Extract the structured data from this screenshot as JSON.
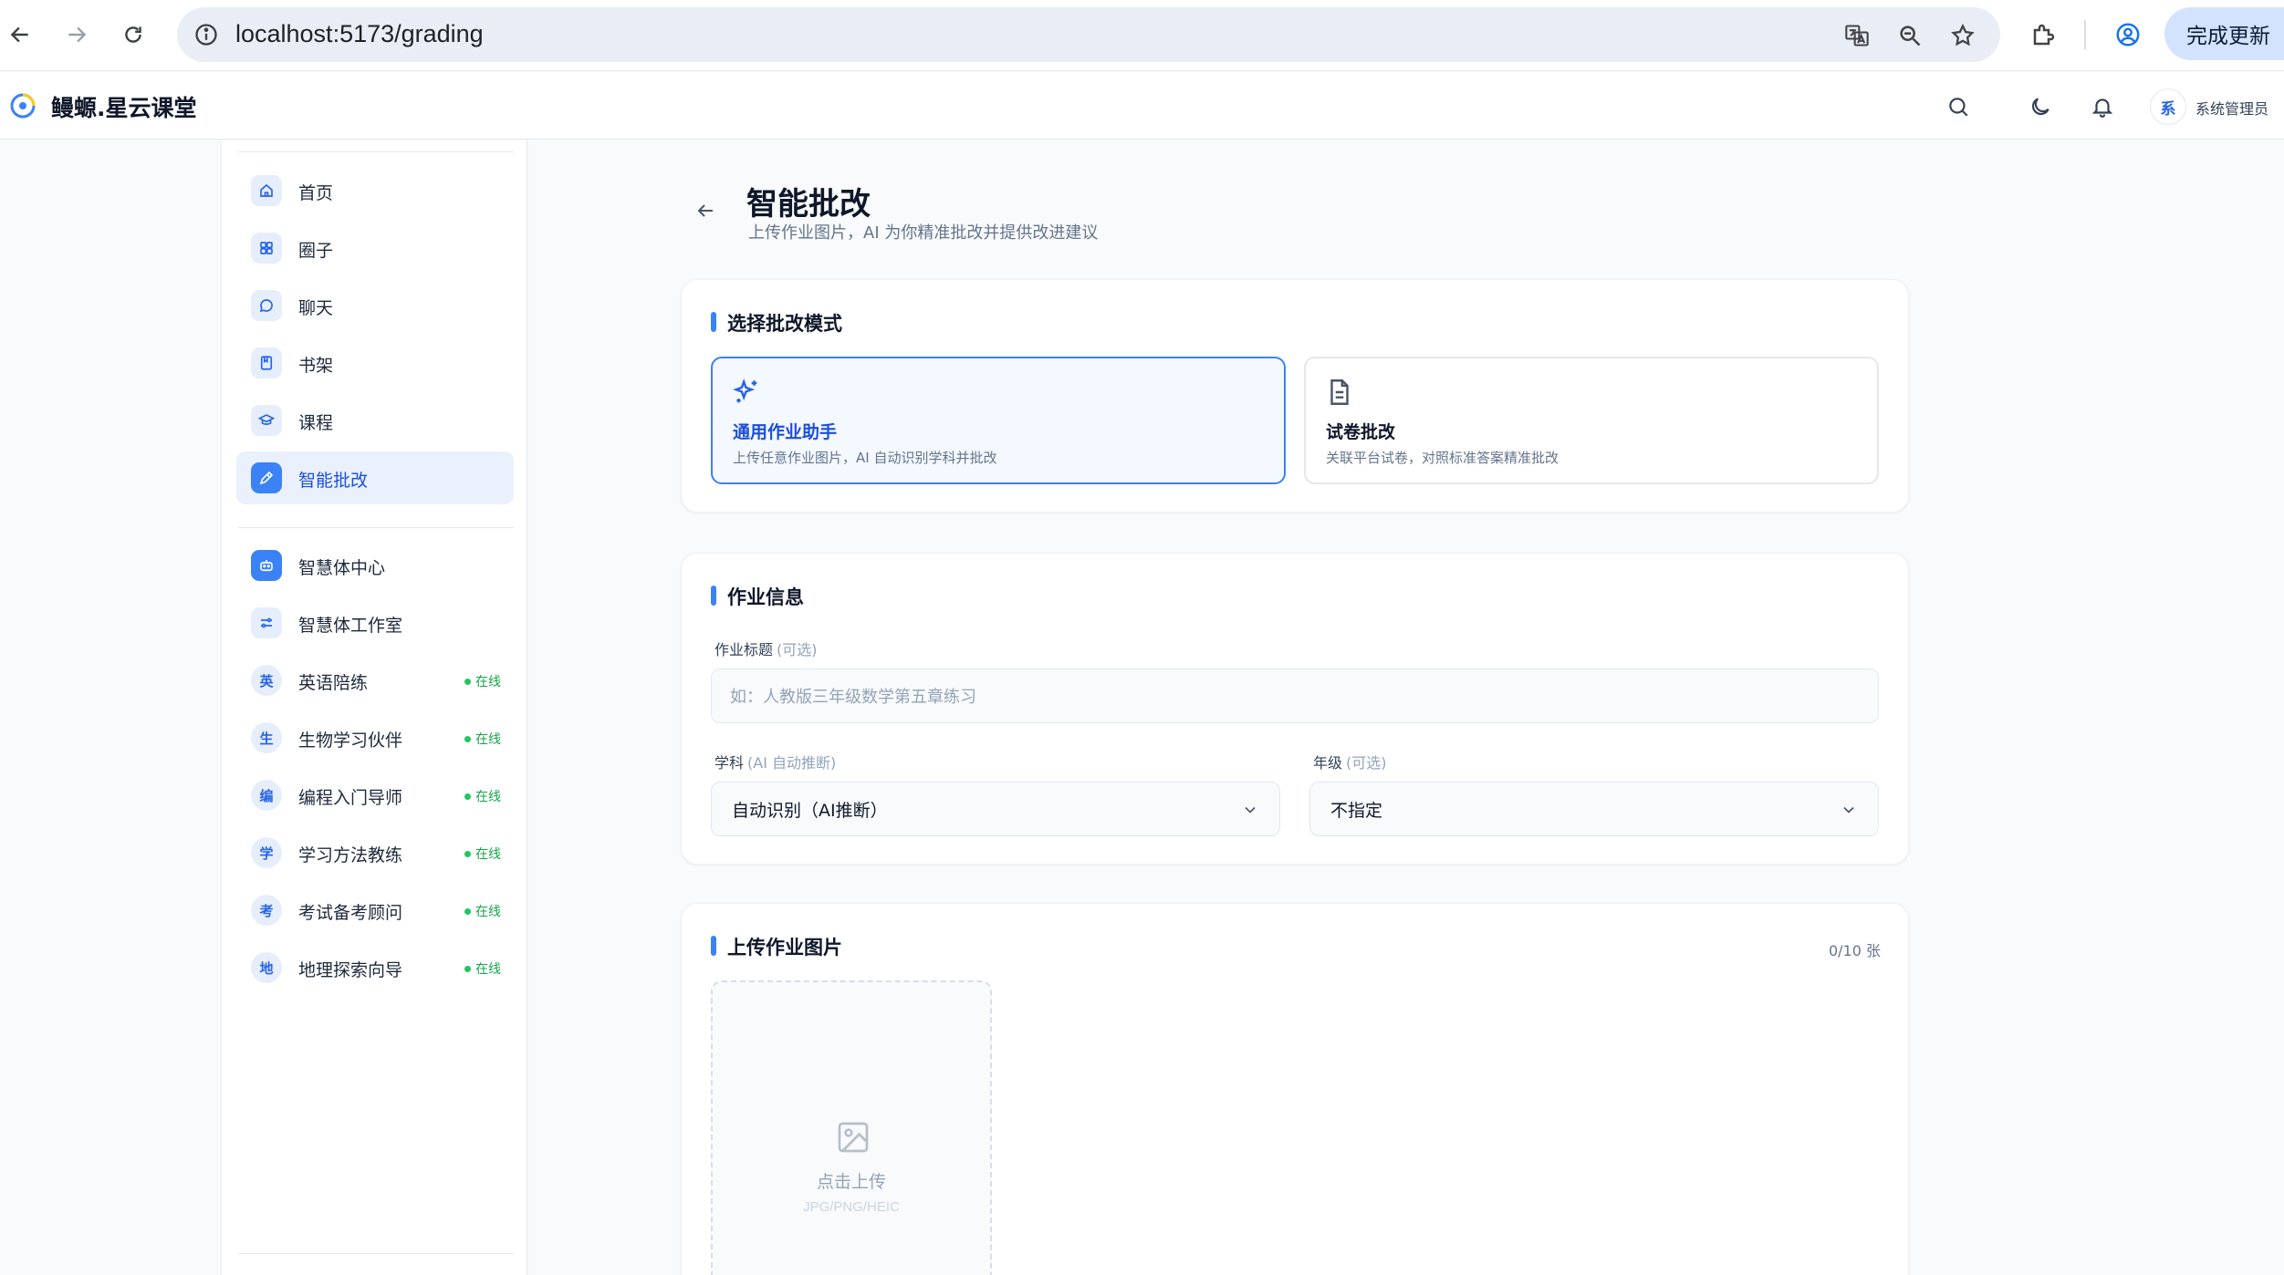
{
  "browser": {
    "url": "localhost:5173/grading",
    "update_label": "完成更新"
  },
  "header": {
    "brand": "鳗螈.星云课堂",
    "user_avatar_char": "系",
    "user_name": "系统管理员"
  },
  "sidebar": {
    "nav": [
      {
        "label": "首页",
        "icon": "home-icon"
      },
      {
        "label": "圈子",
        "icon": "grid-icon"
      },
      {
        "label": "聊天",
        "icon": "chat-icon"
      },
      {
        "label": "书架",
        "icon": "book-icon"
      },
      {
        "label": "课程",
        "icon": "graduation-cap-icon"
      },
      {
        "label": "智能批改",
        "icon": "pen-icon",
        "active": true
      }
    ],
    "agents": [
      {
        "label": "智慧体中心",
        "icon": "robot-icon"
      },
      {
        "label": "智慧体工作室",
        "icon": "sliders-icon"
      },
      {
        "label": "英语陪练",
        "avatar": "英",
        "status": "在线"
      },
      {
        "label": "生物学习伙伴",
        "avatar": "生",
        "status": "在线"
      },
      {
        "label": "编程入门导师",
        "avatar": "编",
        "status": "在线"
      },
      {
        "label": "学习方法教练",
        "avatar": "学",
        "status": "在线"
      },
      {
        "label": "考试备考顾问",
        "avatar": "考",
        "status": "在线"
      },
      {
        "label": "地理探索向导",
        "avatar": "地",
        "status": "在线"
      }
    ]
  },
  "page": {
    "title": "智能批改",
    "subtitle": "上传作业图片，AI 为你精准批改并提供改进建议"
  },
  "mode_card": {
    "title": "选择批改模式",
    "modes": [
      {
        "title": "通用作业助手",
        "desc": "上传任意作业图片，AI 自动识别学科并批改",
        "icon": "sparkles-icon",
        "selected": true
      },
      {
        "title": "试卷批改",
        "desc": "关联平台试卷，对照标准答案精准批改",
        "icon": "document-icon",
        "selected": false
      }
    ]
  },
  "info_card": {
    "title": "作业信息",
    "homework_title_label": "作业标题",
    "homework_title_optional": "(可选)",
    "homework_title_placeholder": "如：人教版三年级数学第五章练习",
    "subject_label": "学科",
    "subject_hint": "(AI 自动推断)",
    "subject_value": "自动识别（AI推断）",
    "grade_label": "年级",
    "grade_hint": "(可选)",
    "grade_value": "不指定"
  },
  "upload_card": {
    "title": "上传作业图片",
    "counter": "0/10 张",
    "upload_label": "点击上传",
    "upload_hint": "JPG/PNG/HEIC"
  },
  "colors": {
    "accent": "#3b82f6",
    "accent_dark": "#1d4ed8",
    "online": "#22c55e"
  }
}
